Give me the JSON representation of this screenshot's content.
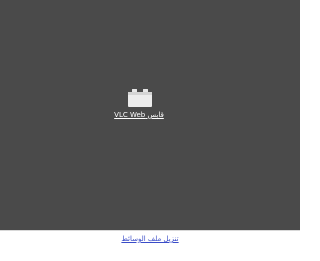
{
  "player": {
    "background_color": "#4a4a4a",
    "plugin": {
      "icon": "plugin-brick-icon",
      "label": "قابس VLC Web"
    }
  },
  "footer": {
    "download_link": "تنزيل ملف الوسائط",
    "link_color": "#3a4cc8"
  }
}
